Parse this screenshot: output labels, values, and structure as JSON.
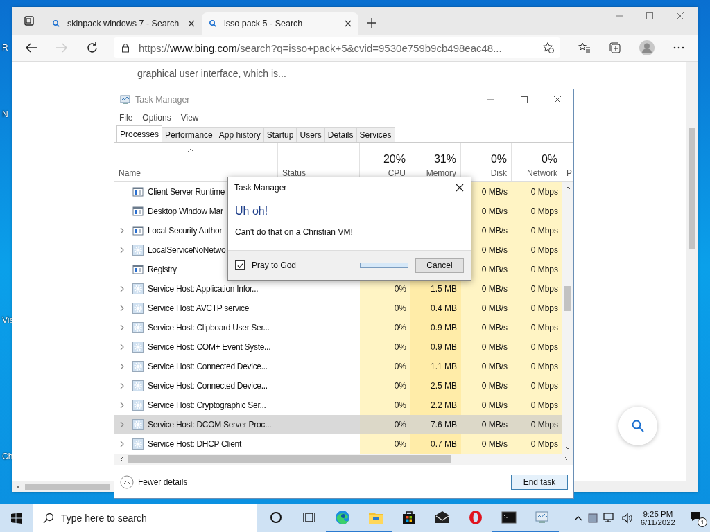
{
  "desktop": {
    "icon_labels": [
      "R",
      "N",
      "Vis",
      "Ch"
    ]
  },
  "browser": {
    "tabs": [
      {
        "title": "skinpack windows 7 - Search",
        "selected": false
      },
      {
        "title": "isso pack 5 - Search",
        "selected": true
      }
    ],
    "address": {
      "prefix": "https://",
      "domain": "www.bing.com",
      "path": "/search?q=isso+pack+5&cvid=9530e759b9cb498eac48..."
    },
    "page_text": "graphical user interface, which is..."
  },
  "task_manager": {
    "title": "Task Manager",
    "menu": [
      "File",
      "Options",
      "View"
    ],
    "tabs": [
      {
        "label": "Processes",
        "selected": true
      },
      {
        "label": "Performance",
        "selected": false
      },
      {
        "label": "App history",
        "selected": false
      },
      {
        "label": "Startup",
        "selected": false
      },
      {
        "label": "Users",
        "selected": false
      },
      {
        "label": "Details",
        "selected": false
      },
      {
        "label": "Services",
        "selected": false
      }
    ],
    "columns": [
      {
        "label": "Name"
      },
      {
        "label": "Status"
      },
      {
        "percent": "20%",
        "label": "CPU"
      },
      {
        "percent": "31%",
        "label": "Memory"
      },
      {
        "percent": "0%",
        "label": "Disk"
      },
      {
        "percent": "0%",
        "label": "Network"
      },
      {
        "label": "P"
      }
    ],
    "rows": [
      {
        "kind": "app",
        "expandable": false,
        "selected": false,
        "name": "Client Server Runtime",
        "disk": "0 MB/s",
        "network": "0 Mbps"
      },
      {
        "kind": "app",
        "expandable": false,
        "selected": false,
        "name": "Desktop Window Mar",
        "disk": "0 MB/s",
        "network": "0 Mbps"
      },
      {
        "kind": "app",
        "expandable": true,
        "selected": false,
        "name": "Local Security Author",
        "disk": "0 MB/s",
        "network": "0 Mbps"
      },
      {
        "kind": "service",
        "expandable": true,
        "selected": false,
        "name": "LocalServiceNoNetwo",
        "disk": "0 MB/s",
        "network": "0 Mbps"
      },
      {
        "kind": "app",
        "expandable": false,
        "selected": false,
        "name": "Registry",
        "disk": "0 MB/s",
        "network": "0 Mbps"
      },
      {
        "kind": "service",
        "expandable": true,
        "selected": false,
        "name": "Service Host: Application Infor...",
        "cpu": "0%",
        "memory": "1.5 MB",
        "disk": "0 MB/s",
        "network": "0 Mbps"
      },
      {
        "kind": "service",
        "expandable": true,
        "selected": false,
        "name": "Service Host: AVCTP service",
        "cpu": "0%",
        "memory": "0.4 MB",
        "disk": "0 MB/s",
        "network": "0 Mbps"
      },
      {
        "kind": "service",
        "expandable": true,
        "selected": false,
        "name": "Service Host: Clipboard User Ser...",
        "cpu": "0%",
        "memory": "0.9 MB",
        "disk": "0 MB/s",
        "network": "0 Mbps"
      },
      {
        "kind": "service",
        "expandable": true,
        "selected": false,
        "name": "Service Host: COM+ Event Syste...",
        "cpu": "0%",
        "memory": "0.9 MB",
        "disk": "0 MB/s",
        "network": "0 Mbps"
      },
      {
        "kind": "service",
        "expandable": true,
        "selected": false,
        "name": "Service Host: Connected Device...",
        "cpu": "0%",
        "memory": "1.1 MB",
        "disk": "0 MB/s",
        "network": "0 Mbps"
      },
      {
        "kind": "service",
        "expandable": true,
        "selected": false,
        "name": "Service Host: Connected Device...",
        "cpu": "0%",
        "memory": "2.5 MB",
        "disk": "0 MB/s",
        "network": "0 Mbps"
      },
      {
        "kind": "service",
        "expandable": true,
        "selected": false,
        "name": "Service Host: Cryptographic Ser...",
        "cpu": "0%",
        "memory": "2.2 MB",
        "disk": "0 MB/s",
        "network": "0 Mbps"
      },
      {
        "kind": "service",
        "expandable": true,
        "selected": true,
        "name": "Service Host: DCOM Server Proc...",
        "cpu": "0%",
        "memory": "7.6 MB",
        "disk": "0 MB/s",
        "network": "0 Mbps"
      },
      {
        "kind": "service",
        "expandable": true,
        "selected": false,
        "name": "Service Host: DHCP Client",
        "cpu": "0%",
        "memory": "0.7 MB",
        "disk": "0 MB/s",
        "network": "0 Mbps"
      }
    ],
    "fewer_details": "Fewer details",
    "end_task": "End task"
  },
  "dialog": {
    "title": "Task Manager",
    "heading": "Uh oh!",
    "message": "Can't do that on a Christian VM!",
    "checkbox": {
      "label": "Pray to God",
      "checked": true
    },
    "progress": {
      "level": 1
    },
    "button": "Cancel"
  },
  "taskbar": {
    "search_placeholder": "Type here to search",
    "apps": [
      {
        "kind": "cortana",
        "running": false
      },
      {
        "kind": "taskview",
        "running": false
      },
      {
        "kind": "edge",
        "running": true
      },
      {
        "kind": "explorer",
        "running": true
      },
      {
        "kind": "store",
        "running": false
      },
      {
        "kind": "mail",
        "running": false
      },
      {
        "kind": "opera",
        "running": false
      },
      {
        "kind": "terminal",
        "running": true
      },
      {
        "kind": "taskmgr",
        "running": true
      }
    ],
    "time": "9:25 PM",
    "date": "6/11/2022",
    "notifications": "1"
  }
}
